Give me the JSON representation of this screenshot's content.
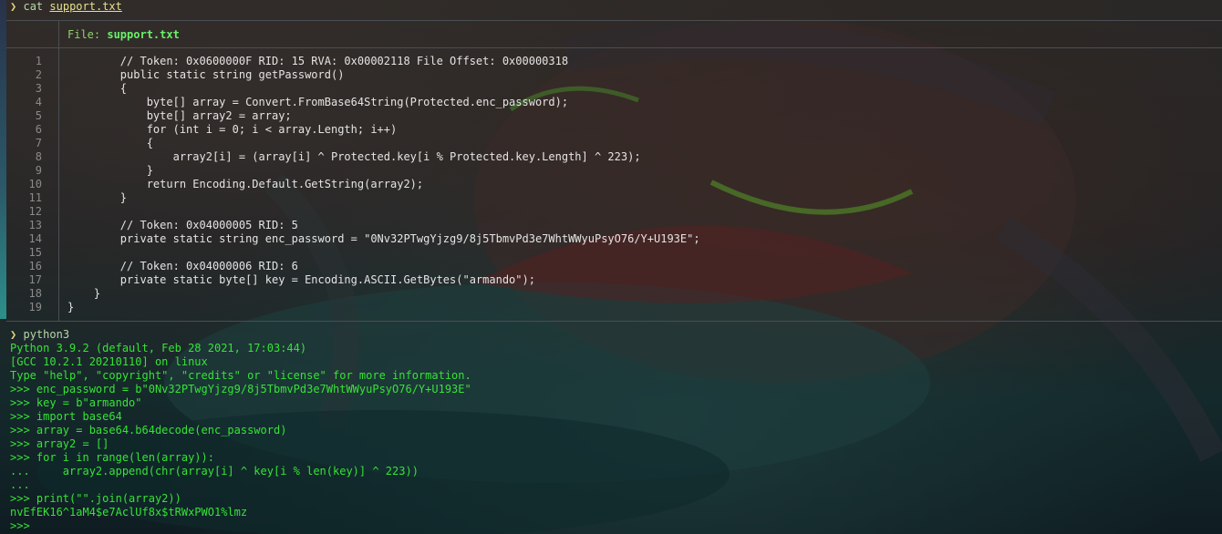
{
  "first_command": {
    "prompt": "❯",
    "command": "cat",
    "argument": "support.txt"
  },
  "bat": {
    "header_label": "File: ",
    "header_file": "support.txt",
    "lines": [
      {
        "n": "1",
        "text": "        // Token: 0x0600000F RID: 15 RVA: 0x00002118 File Offset: 0x00000318"
      },
      {
        "n": "2",
        "text": "        public static string getPassword()"
      },
      {
        "n": "3",
        "text": "        {"
      },
      {
        "n": "4",
        "text": "            byte[] array = Convert.FromBase64String(Protected.enc_password);"
      },
      {
        "n": "5",
        "text": "            byte[] array2 = array;"
      },
      {
        "n": "6",
        "text": "            for (int i = 0; i < array.Length; i++)"
      },
      {
        "n": "7",
        "text": "            {"
      },
      {
        "n": "8",
        "text": "                array2[i] = (array[i] ^ Protected.key[i % Protected.key.Length] ^ 223);"
      },
      {
        "n": "9",
        "text": "            }"
      },
      {
        "n": "10",
        "text": "            return Encoding.Default.GetString(array2);"
      },
      {
        "n": "11",
        "text": "        }"
      },
      {
        "n": "12",
        "text": ""
      },
      {
        "n": "13",
        "text": "        // Token: 0x04000005 RID: 5"
      },
      {
        "n": "14",
        "text": "        private static string enc_password = \"0Nv32PTwgYjzg9/8j5TbmvPd3e7WhtWWyuPsyO76/Y+U193E\";"
      },
      {
        "n": "15",
        "text": ""
      },
      {
        "n": "16",
        "text": "        // Token: 0x04000006 RID: 6"
      },
      {
        "n": "17",
        "text": "        private static byte[] key = Encoding.ASCII.GetBytes(\"armando\");"
      },
      {
        "n": "18",
        "text": "    }"
      },
      {
        "n": "19",
        "text": "}"
      }
    ]
  },
  "second_command": {
    "prompt": "❯",
    "command": "python3"
  },
  "python_session": [
    "Python 3.9.2 (default, Feb 28 2021, 17:03:44)",
    "[GCC 10.2.1 20210110] on linux",
    "Type \"help\", \"copyright\", \"credits\" or \"license\" for more information.",
    ">>> enc_password = b\"0Nv32PTwgYjzg9/8j5TbmvPd3e7WhtWWyuPsyO76/Y+U193E\"",
    ">>> key = b\"armando\"",
    ">>> import base64",
    ">>> array = base64.b64decode(enc_password)",
    ">>> array2 = []",
    ">>> for i in range(len(array)):",
    "...     array2.append(chr(array[i] ^ key[i % len(key)] ^ 223))",
    "...",
    ">>> print(\"\".join(array2))",
    "nvEfEK16^1aM4$e7AclUf8x$tRWxPWO1%lmz",
    ">>> "
  ],
  "colors": {
    "terminal_green": "#36e336",
    "prompt_yellow": "#e0d47a",
    "line_number_gray": "#8a8a8a",
    "code_text": "#e4e4e4"
  }
}
